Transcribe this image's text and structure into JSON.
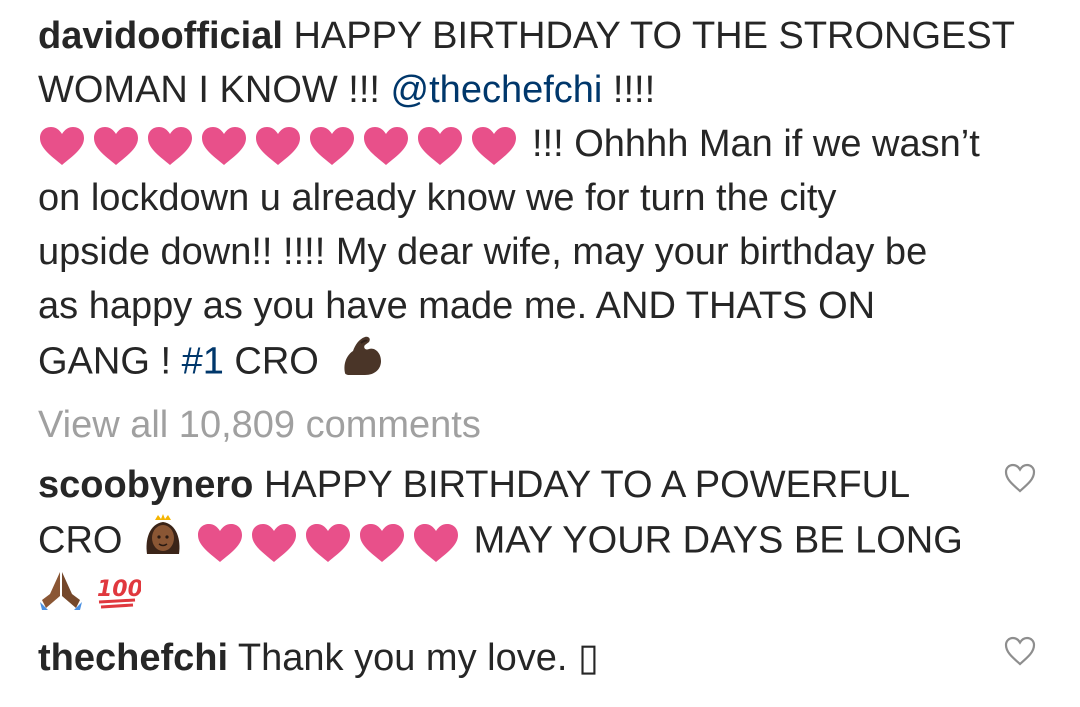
{
  "caption": {
    "username": "davidoofficial",
    "line1_text": "HAPPY BIRTHDAY TO THE STRONGEST",
    "line2_text": "WOMAN I KNOW !!! ",
    "mention": "@thechefchi",
    "line2_after": " !!!!",
    "line3_text": "!!! Ohhhh Man if we wasn’t",
    "line4_text": "on lockdown u already know we for turn the city",
    "line5_text": "upside down!! !!!! My dear wife, may your birthday be",
    "line6_text": "as happy as you have made me. AND THATS ON",
    "line7_prefix": "GANG ! ",
    "hashtag": "#1",
    "line7_suffix": " CRO",
    "hearts_count": 9,
    "flex_emoji": "flexed-biceps-icon"
  },
  "view_all_comments": "View all 10,809 comments",
  "comments": [
    {
      "username": "scoobynero",
      "line1_text": "HAPPY BIRTHDAY TO A POWERFUL",
      "line2_prefix": "CRO",
      "line2_suffix": "MAY YOUR DAYS BE LONG",
      "hearts_count": 5
    },
    {
      "username": "thechefchi",
      "text": "Thank you my love. ▯"
    }
  ],
  "colors": {
    "text": "#262626",
    "link": "#00376b",
    "muted": "#a0a0a0",
    "heart": "#e8508a"
  }
}
